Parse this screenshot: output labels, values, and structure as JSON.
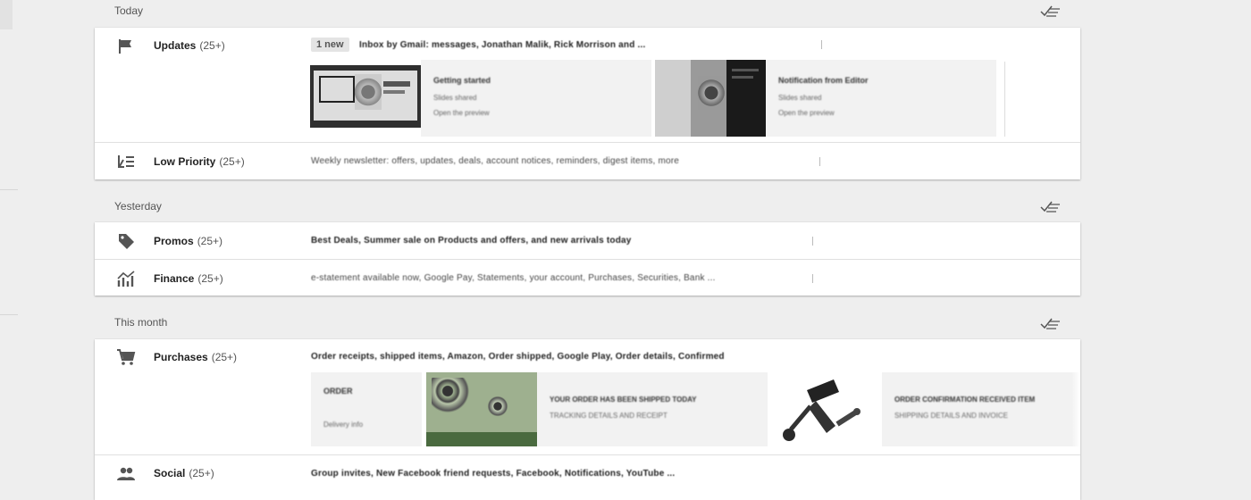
{
  "sections": [
    {
      "title": "Today",
      "bundles": [
        {
          "name": "Updates",
          "count": "(25+)",
          "icon": "flag-icon",
          "badge": "1 new",
          "snippet": "Inbox by Gmail: messages, Jonathan Malik, Rick Morrison and ...",
          "cards": [
            {
              "title": "Getting started",
              "line1": "Slides shared",
              "line2": "Open the preview"
            },
            {
              "title": "Notification from Editor",
              "line1": "Slides shared",
              "line2": "Open the preview"
            }
          ]
        },
        {
          "name": "Low Priority",
          "count": "(25+)",
          "icon": "low-priority-icon",
          "snippet": "Weekly newsletter: offers, updates, deals, account notices, reminders, digest items, more"
        }
      ]
    },
    {
      "title": "Yesterday",
      "bundles": [
        {
          "name": "Promos",
          "count": "(25+)",
          "icon": "tag-icon",
          "snippet": "Best Deals, Summer sale on Products and offers, and new arrivals today"
        },
        {
          "name": "Finance",
          "count": "(25+)",
          "icon": "finance-chart-icon",
          "snippet": "e-statement available now, Google Pay, Statements, your account, Purchases, Securities, Bank ..."
        }
      ]
    },
    {
      "title": "This month",
      "bundles": [
        {
          "name": "Purchases",
          "count": "(25+)",
          "icon": "cart-icon",
          "snippet": "Order receipts, shipped items, Amazon, Order shipped, Google Play, Order details, Confirmed",
          "cards": [
            {
              "title": "ORDER",
              "line1": "Delivery info"
            },
            {
              "title": "YOUR ORDER HAS BEEN SHIPPED TODAY",
              "line1": "TRACKING DETAILS AND RECEIPT",
              "accent": "#4a6a3f"
            },
            {
              "title": "ORDER CONFIRMATION RECEIVED ITEM",
              "line1": "SHIPPING DETAILS AND INVOICE"
            }
          ]
        },
        {
          "name": "Social",
          "count": "(25+)",
          "icon": "people-icon",
          "snippet": "Group invites, New Facebook friend requests, Facebook, Notifications, YouTube ..."
        }
      ]
    }
  ],
  "colors": {
    "background": "#eeeeee",
    "card": "#ffffff",
    "icon": "#555555",
    "divider": "#e0e0e0"
  }
}
